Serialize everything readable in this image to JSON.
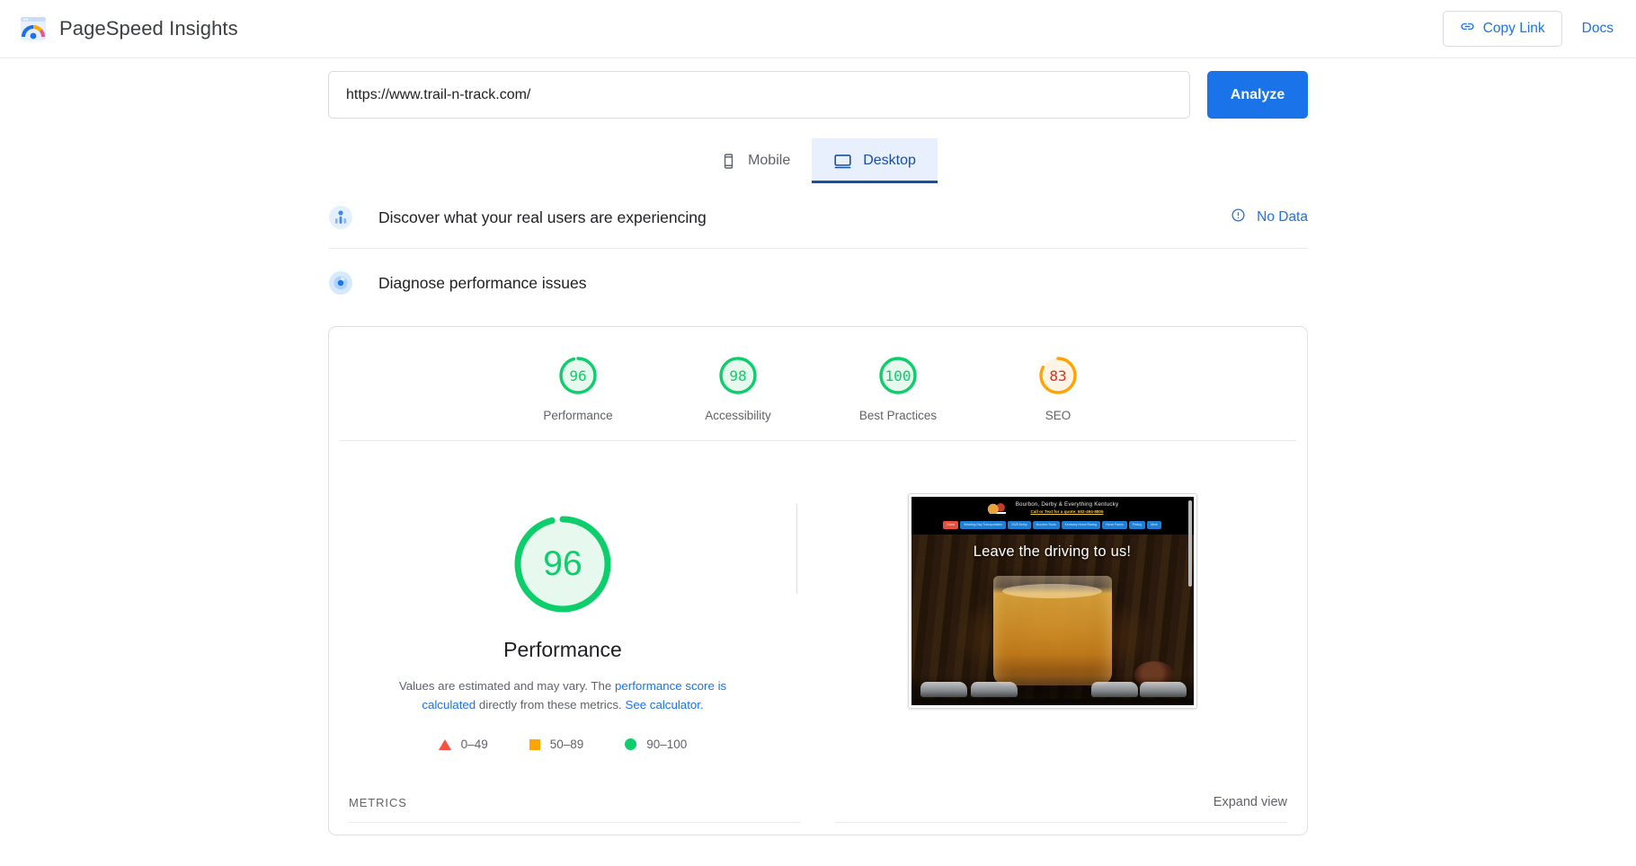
{
  "header": {
    "app_title": "PageSpeed Insights",
    "logo_icon": "pagespeed-logo-icon",
    "copy_link_label": "Copy Link",
    "copy_link_icon": "link-icon",
    "docs_label": "Docs"
  },
  "search": {
    "url_value": "https://www.trail-n-track.com/",
    "url_placeholder": "Enter a web page URL",
    "analyze_label": "Analyze"
  },
  "device_tabs": [
    {
      "label": "Mobile",
      "icon": "mobile-icon",
      "active": false
    },
    {
      "label": "Desktop",
      "icon": "desktop-icon",
      "active": true
    }
  ],
  "field_data": {
    "title": "Discover what your real users are experiencing",
    "icon": "real-user-data-icon",
    "status_label": "No Data",
    "status_icon": "info-icon"
  },
  "lab_data": {
    "title": "Diagnose performance issues",
    "icon": "diagnose-icon"
  },
  "category_scores": [
    {
      "label": "Performance",
      "score": "96",
      "color": "#0cce6b",
      "track": "#e7f8ef"
    },
    {
      "label": "Accessibility",
      "score": "98",
      "color": "#0cce6b",
      "track": "#e7f8ef"
    },
    {
      "label": "Best Practices",
      "score": "100",
      "color": "#0cce6b",
      "track": "#e7f8ef"
    },
    {
      "label": "SEO",
      "score": "83",
      "color": "#ffa400",
      "track": "#fef4e5"
    }
  ],
  "main_gauge": {
    "score": "96",
    "label": "Performance",
    "color": "#0cce6b",
    "disclaimer_prefix": "Values are estimated and may vary. The ",
    "disclaimer_link1": "performance score is calculated",
    "disclaimer_middle": " directly from these metrics. ",
    "disclaimer_link2": "See calculator."
  },
  "legend": [
    {
      "shape": "triangle",
      "range": "0–49",
      "color": "#ff4e42"
    },
    {
      "shape": "square",
      "range": "50–89",
      "color": "#ffa400"
    },
    {
      "shape": "circle",
      "range": "90–100",
      "color": "#0cce6b"
    }
  ],
  "thumbnail": {
    "name": "page-screenshot",
    "site_title": "Bourbon, Derby & Everything Kentucky",
    "site_subtitle": "Call or Text for a quote: 502-494-8805",
    "nav_items": [
      "Home",
      "Wedding Day Transportation",
      "2025 Derby",
      "Bourbon Tours",
      "Kentucky Horse Racing",
      "Horse Farms",
      "Pricing",
      "More"
    ],
    "hero_text": "Leave the driving to us!"
  },
  "metrics_footer": {
    "label": "METRICS",
    "expand_label": "Expand view"
  }
}
